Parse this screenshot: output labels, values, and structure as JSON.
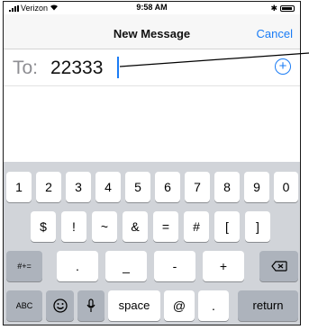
{
  "status": {
    "carrier": "Verizon",
    "time": "9:58 AM"
  },
  "nav": {
    "title": "New Message",
    "cancel": "Cancel"
  },
  "recipient": {
    "label": "To:",
    "value": "22333"
  },
  "keyboard": {
    "row1": [
      "1",
      "2",
      "3",
      "4",
      "5",
      "6",
      "7",
      "8",
      "9",
      "0"
    ],
    "row2": [
      "$",
      "!",
      "~",
      "&",
      "=",
      "#",
      "[",
      "]"
    ],
    "row3": {
      "mode": "#+=",
      "keys": [
        ".",
        "_",
        "-",
        "+"
      ]
    },
    "row4": {
      "abc": "ABC",
      "space": "space",
      "at": "@",
      "dot": ".",
      "return": "return"
    }
  },
  "icons": [
    "wifi-icon",
    "bluetooth-icon",
    "battery-icon",
    "add-contact-icon",
    "delete-icon",
    "emoji-icon",
    "microphone-icon"
  ]
}
